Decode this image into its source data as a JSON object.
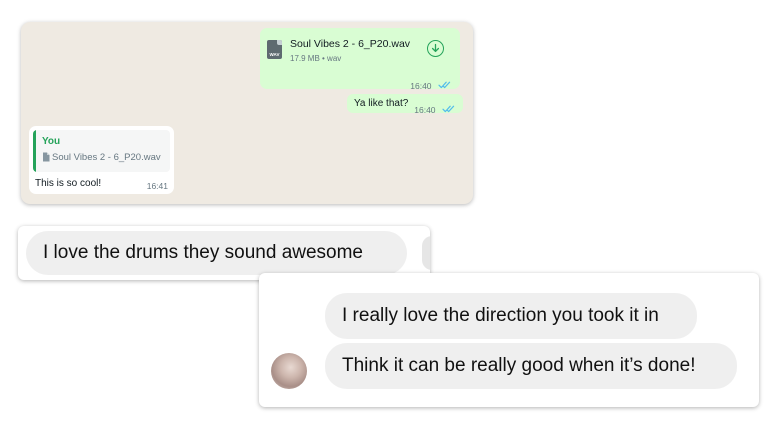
{
  "whatsapp": {
    "file_message": {
      "file_type": "WAV",
      "file_name": "Soul Vibes 2 - 6_P20.wav",
      "file_meta": "17.9 MB • wav",
      "time": "16:40",
      "status": "read"
    },
    "outgoing_reply": {
      "text": "Ya like that?",
      "time": "16:40",
      "status": "read"
    },
    "incoming_message": {
      "quote_author": "You",
      "quote_text": "Soul Vibes 2 - 6_P20.wav",
      "text": "This is so cool!",
      "time": "16:41"
    },
    "colors": {
      "chat_background": "#efeae2",
      "outgoing_bubble": "#d9fdd3",
      "accent_green": "#25a35a",
      "read_ticks": "#53bdeb"
    }
  },
  "instagram_top": {
    "message": "I love the drums they sound awesome"
  },
  "instagram_bottom": {
    "messages": [
      "I really love the direction you took it in",
      "Think it can be really good when it’s done!"
    ],
    "colors": {
      "bubble": "#efefef"
    }
  }
}
